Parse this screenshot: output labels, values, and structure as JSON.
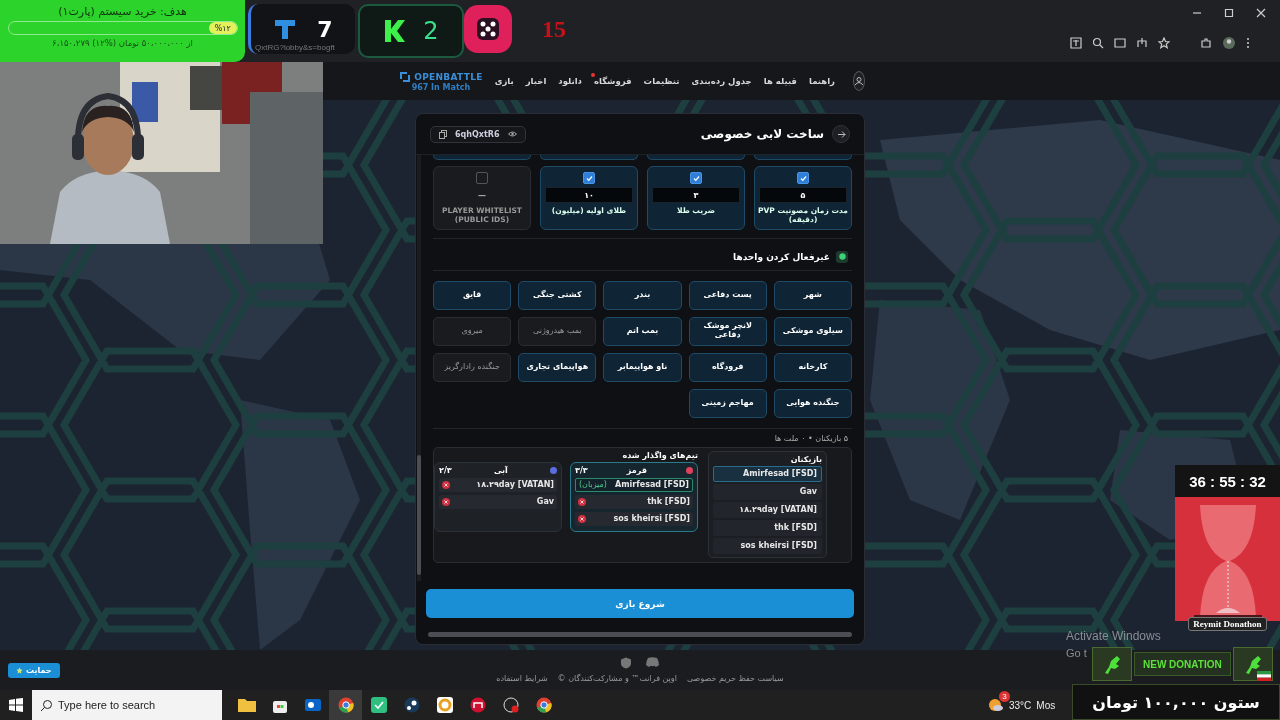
{
  "overlay": {
    "goal": {
      "title": "هدف: خرید سیستم (پارت۱)",
      "level": 0.12,
      "percent": "%۱۲",
      "progress": "۶،۱۵۰،۲۷۹ از ۵۰،۰۰۰،۰۰۰ تومان (%۱۲)"
    },
    "t_counter": {
      "value": "7",
      "caption": "QxtRG?lobby&s=bogft"
    },
    "k_counter": {
      "value": "2"
    },
    "dice_counter": {
      "value": "15"
    },
    "timer": {
      "time": "36 : 55 : 32",
      "caption": "Reymit Donathon"
    },
    "donation": {
      "title": "NEW DONATION",
      "amount": "ستون ۱۰۰,۰۰۰ تومان"
    }
  },
  "nav": {
    "logo": "OPENBATTLE",
    "status": "967 In Match",
    "items": [
      {
        "label": "راهنما",
        "badge": false
      },
      {
        "label": "قبیله ها",
        "badge": false
      },
      {
        "label": "جدول رده‌بندی",
        "badge": false
      },
      {
        "label": "تنظیمات",
        "badge": false
      },
      {
        "label": "فروشگاه",
        "badge": true
      },
      {
        "label": "دانلود",
        "badge": false
      },
      {
        "label": "اخبار",
        "badge": false
      },
      {
        "label": "بازی",
        "badge": false
      }
    ]
  },
  "lobby": {
    "title": "ساخت لابی خصوصی",
    "code": "6qhQxtR6",
    "options": [
      {
        "label": "مدت زمان مصونیت PVP (دقیقه)",
        "checked": true,
        "value": "۵"
      },
      {
        "label": "ضریب طلا",
        "checked": true,
        "value": "۳"
      },
      {
        "label": "طلای اولیه (میلیون)",
        "checked": true,
        "value": "۱۰"
      },
      {
        "label": "PLAYER WHITELIST (PUBLIC IDS)",
        "checked": false,
        "value": "—"
      }
    ],
    "units_title": "غیرفعال کردن واحدها",
    "units": [
      {
        "label": "شهر",
        "active": true
      },
      {
        "label": "پست دفاعی",
        "active": true
      },
      {
        "label": "بندر",
        "active": true
      },
      {
        "label": "کشتی جنگی",
        "active": true
      },
      {
        "label": "قایق",
        "active": true
      },
      {
        "label": "سیلوی موشکی",
        "active": true
      },
      {
        "label": "لانچر موشک دفاعی",
        "active": true
      },
      {
        "label": "بمب اتم",
        "active": true
      },
      {
        "label": "بمب هیدروژنی",
        "active": false
      },
      {
        "label": "میروی",
        "active": false
      },
      {
        "label": "کارخانه",
        "active": true
      },
      {
        "label": "فرودگاه",
        "active": true
      },
      {
        "label": "ناو هواپیمابر",
        "active": true
      },
      {
        "label": "هواپیمای تجاری",
        "active": true
      },
      {
        "label": "جنگنده رادارگریز",
        "active": false
      },
      {
        "label": "جنگنده هوایی",
        "active": true
      },
      {
        "label": "مهاجم زمینی",
        "active": true
      }
    ],
    "summary": "۵ بازیکنان • ۰ ملت ها",
    "players_title": "بازیکنان",
    "players": [
      {
        "name": "Amirfesad [FSD]",
        "selected": true
      },
      {
        "name": "Gav",
        "selected": false
      },
      {
        "name": "۱۸.۲۹day [VATAN]",
        "selected": false
      },
      {
        "name": "thk [FSD]",
        "selected": false
      },
      {
        "name": "sos kheirsi [FSD]",
        "selected": false
      }
    ],
    "teams_title": "تیم‌های واگذار شده",
    "teams": [
      {
        "name": "قرمز",
        "count": "۳/۳",
        "color": "#e0405a",
        "selected": true,
        "members": [
          {
            "name": "Amirfesad [FSD]",
            "tag": "(میزبان)",
            "host": true
          },
          {
            "name": "thk [FSD]",
            "host": false
          },
          {
            "name": "sos kheirsi [FSD]",
            "host": false
          }
        ]
      },
      {
        "name": "آبی",
        "count": "۲/۳",
        "color": "#5a6ee0",
        "selected": false,
        "members": [
          {
            "name": "۱۸.۲۹day [VATAN]",
            "host": false
          },
          {
            "name": "Gav",
            "host": false
          }
        ]
      }
    ],
    "start_button": "شروع بازی"
  },
  "footer": {
    "support": "حمایت",
    "links": [
      "سیاست حفظ حریم خصوصی",
      "اوپن فرانت™ و مشارکت‌کنندگان ©",
      "شرایط استفاده"
    ]
  },
  "desktop": {
    "activation_title": "Activate Windows",
    "activation_hint": "Go t"
  },
  "taskbar": {
    "search_placeholder": "Type here to search",
    "weather_badge": "3",
    "temperature": "33°C",
    "weather": "Mos"
  }
}
